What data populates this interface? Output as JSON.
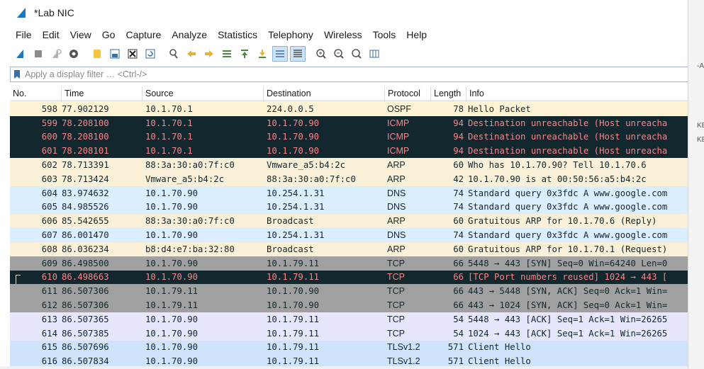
{
  "window": {
    "title": "*Lab NIC"
  },
  "menu": [
    "File",
    "Edit",
    "View",
    "Go",
    "Capture",
    "Analyze",
    "Statistics",
    "Telephony",
    "Wireless",
    "Tools",
    "Help"
  ],
  "toolbar_icons": [
    "start-capture-icon",
    "stop-capture-icon",
    "restart-capture-icon",
    "capture-options-icon",
    "open-file-icon",
    "save-file-icon",
    "close-file-icon",
    "reload-file-icon",
    "find-packet-icon",
    "go-back-icon",
    "go-forward-icon",
    "go-to-packet-icon",
    "go-first-icon",
    "go-last-icon",
    "autoscroll-icon",
    "colorize-icon",
    "zoom-in-icon",
    "zoom-out-icon",
    "normal-size-icon",
    "resize-columns-icon"
  ],
  "filter": {
    "placeholder": "Apply a display filter … <Ctrl-/>"
  },
  "columns": {
    "no": "No.",
    "time": "Time",
    "source": "Source",
    "destination": "Destination",
    "protocol": "Protocol",
    "length": "Length",
    "info": "Info"
  },
  "colors": {
    "icmp_bg": "#12272e",
    "icmp_fg": "#f78787",
    "dns_bg": "#daeeff",
    "arp_bg": "#faf0d7",
    "tcp_bg": "#e7e6ff",
    "tls_bg": "#cfe3fa",
    "tcp_gray_bg": "#a0a0a0"
  },
  "right_edge_fragments": [
    "-A",
    "KE",
    "KE"
  ],
  "packets": [
    {
      "no": "598",
      "time": "77.902129",
      "src": "10.1.70.1",
      "dst": "224.0.0.5",
      "proto": "OSPF",
      "len": "78",
      "info": "Hello Packet",
      "style": "ospf"
    },
    {
      "no": "599",
      "time": "78.208100",
      "src": "10.1.70.1",
      "dst": "10.1.70.90",
      "proto": "ICMP",
      "len": "94",
      "info": "Destination unreachable (Host unreacha",
      "style": "icmp"
    },
    {
      "no": "600",
      "time": "78.208100",
      "src": "10.1.70.1",
      "dst": "10.1.70.90",
      "proto": "ICMP",
      "len": "94",
      "info": "Destination unreachable (Host unreacha",
      "style": "icmp"
    },
    {
      "no": "601",
      "time": "78.208101",
      "src": "10.1.70.1",
      "dst": "10.1.70.90",
      "proto": "ICMP",
      "len": "94",
      "info": "Destination unreachable (Host unreacha",
      "style": "icmp"
    },
    {
      "no": "602",
      "time": "78.713391",
      "src": "88:3a:30:a0:7f:c0",
      "dst": "Vmware_a5:b4:2c",
      "proto": "ARP",
      "len": "60",
      "info": "Who has 10.1.70.90? Tell 10.1.70.6",
      "style": "arp"
    },
    {
      "no": "603",
      "time": "78.713424",
      "src": "Vmware_a5:b4:2c",
      "dst": "88:3a:30:a0:7f:c0",
      "proto": "ARP",
      "len": "42",
      "info": "10.1.70.90 is at 00:50:56:a5:b4:2c",
      "style": "arp"
    },
    {
      "no": "604",
      "time": "83.974632",
      "src": "10.1.70.90",
      "dst": "10.254.1.31",
      "proto": "DNS",
      "len": "74",
      "info": "Standard query 0x3fdc A www.google.com",
      "style": "dns"
    },
    {
      "no": "605",
      "time": "84.985526",
      "src": "10.1.70.90",
      "dst": "10.254.1.31",
      "proto": "DNS",
      "len": "74",
      "info": "Standard query 0x3fdc A www.google.com",
      "style": "dns"
    },
    {
      "no": "606",
      "time": "85.542655",
      "src": "88:3a:30:a0:7f:c0",
      "dst": "Broadcast",
      "proto": "ARP",
      "len": "60",
      "info": "Gratuitous ARP for 10.1.70.6 (Reply)",
      "style": "arp"
    },
    {
      "no": "607",
      "time": "86.001470",
      "src": "10.1.70.90",
      "dst": "10.254.1.31",
      "proto": "DNS",
      "len": "74",
      "info": "Standard query 0x3fdc A www.google.com",
      "style": "dns"
    },
    {
      "no": "608",
      "time": "86.036234",
      "src": "b8:d4:e7:ba:32:80",
      "dst": "Broadcast",
      "proto": "ARP",
      "len": "60",
      "info": "Gratuitous ARP for 10.1.70.1 (Request)",
      "style": "arp"
    },
    {
      "no": "609",
      "time": "86.498500",
      "src": "10.1.70.90",
      "dst": "10.1.79.11",
      "proto": "TCP",
      "len": "66",
      "info": "5448 → 443 [SYN] Seq=0 Win=64240 Len=0",
      "style": "tcpgray"
    },
    {
      "no": "610",
      "time": "86.498663",
      "src": "10.1.70.90",
      "dst": "10.1.79.11",
      "proto": "TCP",
      "len": "66",
      "info": "[TCP Port numbers reused] 1024 → 443 [",
      "style": "tcpbad"
    },
    {
      "no": "611",
      "time": "86.507306",
      "src": "10.1.79.11",
      "dst": "10.1.70.90",
      "proto": "TCP",
      "len": "66",
      "info": "443 → 5448 [SYN, ACK] Seq=0 Ack=1 Win=",
      "style": "tcpgray"
    },
    {
      "no": "612",
      "time": "86.507306",
      "src": "10.1.79.11",
      "dst": "10.1.70.90",
      "proto": "TCP",
      "len": "66",
      "info": "443 → 1024 [SYN, ACK] Seq=0 Ack=1 Win=",
      "style": "tcpgray"
    },
    {
      "no": "613",
      "time": "86.507365",
      "src": "10.1.70.90",
      "dst": "10.1.79.11",
      "proto": "TCP",
      "len": "54",
      "info": "5448 → 443 [ACK] Seq=1 Ack=1 Win=26265",
      "style": "tcp"
    },
    {
      "no": "614",
      "time": "86.507385",
      "src": "10.1.70.90",
      "dst": "10.1.79.11",
      "proto": "TCP",
      "len": "54",
      "info": "1024 → 443 [ACK] Seq=1 Ack=1 Win=26265",
      "style": "tcp"
    },
    {
      "no": "615",
      "time": "86.507696",
      "src": "10.1.70.90",
      "dst": "10.1.79.11",
      "proto": "TLSv1.2",
      "len": "571",
      "info": "Client Hello",
      "style": "tls"
    },
    {
      "no": "616",
      "time": "86.507834",
      "src": "10.1.70.90",
      "dst": "10.1.79.11",
      "proto": "TLSv1.2",
      "len": "571",
      "info": "Client Hello",
      "style": "tls"
    }
  ]
}
